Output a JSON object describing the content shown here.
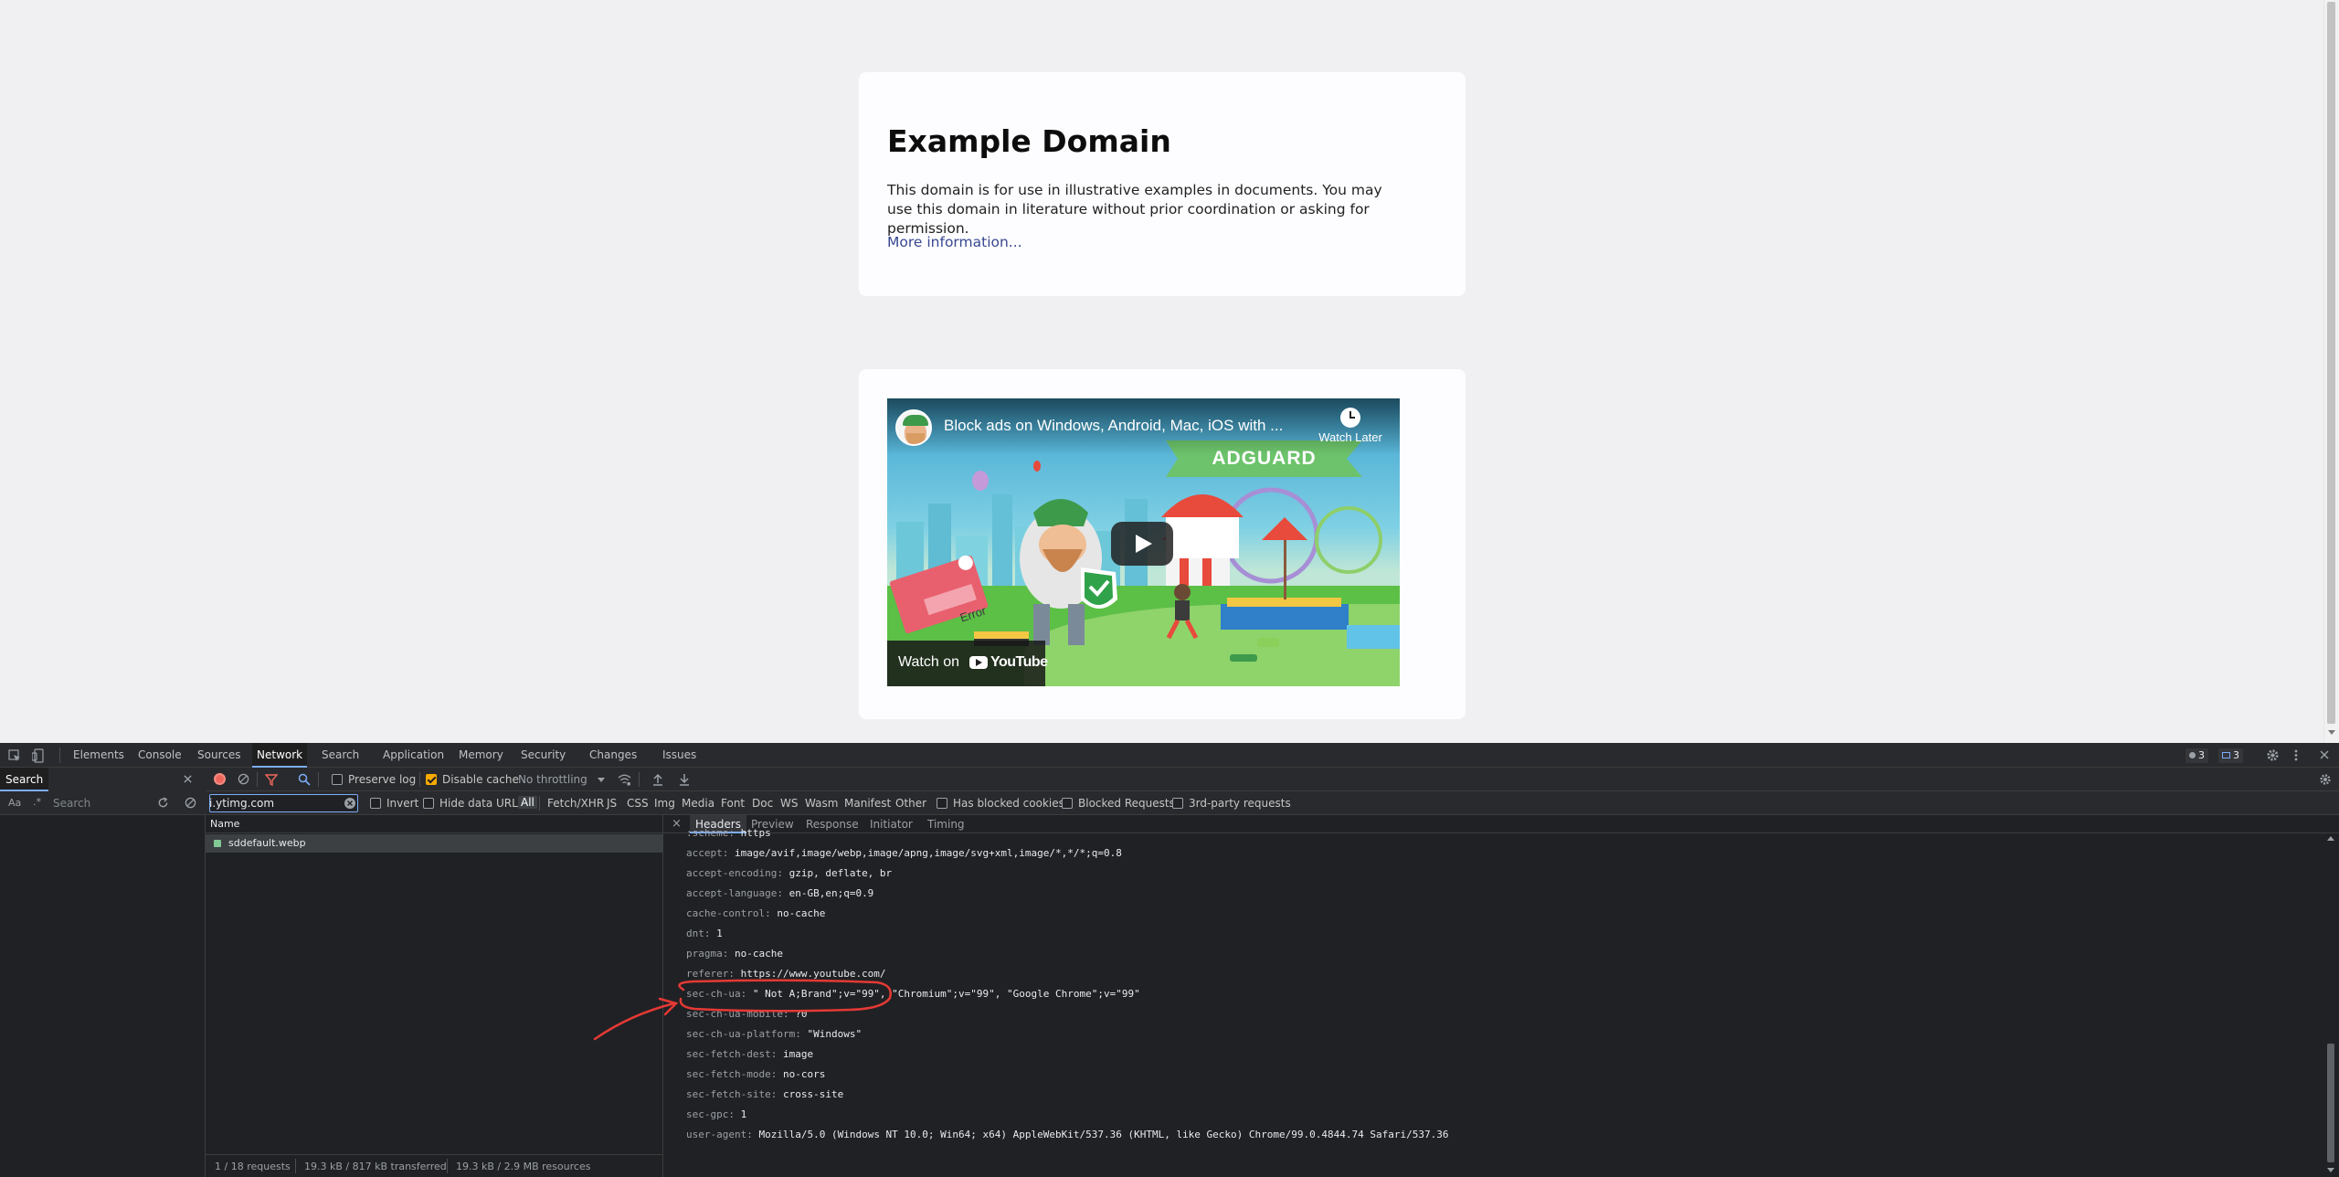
{
  "page": {
    "heading": "Example Domain",
    "paragraph": "This domain is for use in illustrative examples in documents. You may use this domain in literature without prior coordination or asking for permission.",
    "more_link": "More information..."
  },
  "video": {
    "title": "Block ads on Windows, Android, Mac, iOS with ...",
    "watch_later": "Watch Later",
    "brand_banner": "ADGUARD",
    "error_sign": "Error",
    "watch_on": "Watch on",
    "youtube_word": "YouTube"
  },
  "devtools": {
    "tabs": [
      "Elements",
      "Console",
      "Sources",
      "Network",
      "Search",
      "Application",
      "Memory",
      "Security",
      "Changes",
      "Issues"
    ],
    "active_tab": "Network",
    "badges": {
      "errors": "3",
      "messages": "3"
    },
    "search_tab_label": "Search",
    "search_case_label": "Aa",
    "search_regex_label": ".*",
    "search_placeholder": "Search",
    "toolbar": {
      "preserve_log": "Preserve log",
      "disable_cache": "Disable cache",
      "throttling": "No throttling"
    },
    "filter": {
      "value": "i.ytimg.com",
      "invert": "Invert",
      "hide_data_urls": "Hide data URLs",
      "types": [
        "All",
        "Fetch/XHR",
        "JS",
        "CSS",
        "Img",
        "Media",
        "Font",
        "Doc",
        "WS",
        "Wasm",
        "Manifest",
        "Other"
      ],
      "active_type": "All",
      "has_blocked_cookies": "Has blocked cookies",
      "blocked_requests": "Blocked Requests",
      "third_party": "3rd-party requests"
    },
    "request_list": {
      "column_name": "Name",
      "rows": [
        {
          "name": "sddefault.webp"
        }
      ],
      "footer": {
        "requests": "1 / 18 requests",
        "transferred": "19.3 kB / 817 kB transferred",
        "resources": "19.3 kB / 2.9 MB resources"
      }
    },
    "details": {
      "close": "×",
      "tabs": [
        "Headers",
        "Preview",
        "Response",
        "Initiator",
        "Timing"
      ],
      "active_tab": "Headers",
      "headers": [
        {
          "key": ":scheme:",
          "value": "https"
        },
        {
          "key": "accept:",
          "value": "image/avif,image/webp,image/apng,image/svg+xml,image/*,*/*;q=0.8"
        },
        {
          "key": "accept-encoding:",
          "value": "gzip, deflate, br"
        },
        {
          "key": "accept-language:",
          "value": "en-GB,en;q=0.9"
        },
        {
          "key": "cache-control:",
          "value": "no-cache"
        },
        {
          "key": "dnt:",
          "value": "1"
        },
        {
          "key": "pragma:",
          "value": "no-cache"
        },
        {
          "key": "referer:",
          "value": "https://www.youtube.com/"
        },
        {
          "key": "sec-ch-ua:",
          "value": "\" Not A;Brand\";v=\"99\", \"Chromium\";v=\"99\", \"Google Chrome\";v=\"99\""
        },
        {
          "key": "sec-ch-ua-mobile:",
          "value": "?0"
        },
        {
          "key": "sec-ch-ua-platform:",
          "value": "\"Windows\""
        },
        {
          "key": "sec-fetch-dest:",
          "value": "image"
        },
        {
          "key": "sec-fetch-mode:",
          "value": "no-cors"
        },
        {
          "key": "sec-fetch-site:",
          "value": "cross-site"
        },
        {
          "key": "sec-gpc:",
          "value": "1"
        },
        {
          "key": "user-agent:",
          "value": "Mozilla/5.0 (Windows NT 10.0; Win64; x64) AppleWebKit/537.36 (KHTML, like Gecko) Chrome/99.0.4844.74 Safari/537.36"
        }
      ],
      "highlighted_header": "referer:"
    }
  },
  "colors": {
    "annotation": "#e53935",
    "devtools_bg": "#202124",
    "accent_blue": "#7cacf8",
    "page_bg": "#f0f0f2"
  }
}
